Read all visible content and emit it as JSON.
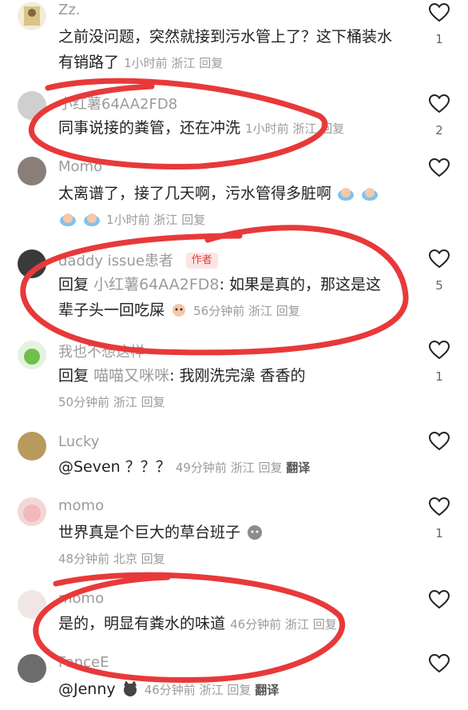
{
  "comments": [
    {
      "name": "Zz.",
      "text": "之前没问题，突然就接到污水管上了？这下桶装水有销路了",
      "time": "1小时前",
      "loc": "浙江",
      "reply": "回复",
      "likes": "1"
    },
    {
      "name": "小红薯64AA2FD8",
      "text": "同事说接的粪管，还在冲洗",
      "time": "1小时前",
      "loc": "浙江",
      "reply": "回复",
      "likes": "2"
    },
    {
      "name": "Momo",
      "text": "太离谱了，接了几天啊，污水管得多脏啊",
      "time": "1小时前",
      "loc": "浙江",
      "reply": "回复",
      "likes": ""
    },
    {
      "name": "daddy issue患者",
      "badge": "作者",
      "reply_prefix": "回复",
      "reply_to": "小红薯64AA2FD8",
      "text": ": 如果是真的，那这是这辈子头一回吃屎",
      "time": "56分钟前",
      "loc": "浙江",
      "reply": "回复",
      "likes": "5"
    },
    {
      "name": "我也不想这样",
      "reply_prefix": "回复",
      "reply_to": "喵喵又咪咪",
      "text": ": 我刚洗完澡 香香的",
      "time": "50分钟前",
      "loc": "浙江",
      "reply": "回复",
      "likes": "1"
    },
    {
      "name": "Lucky",
      "text": "@Seven ？？？",
      "time": "49分钟前",
      "loc": "浙江",
      "reply": "回复",
      "translate": "翻译",
      "likes": ""
    },
    {
      "name": "momo",
      "text": "世界真是个巨大的草台班子",
      "time": "48分钟前",
      "loc": "北京",
      "reply": "回复",
      "likes": "1"
    },
    {
      "name": "momo",
      "text": "是的，明显有粪水的味道",
      "time": "46分钟前",
      "loc": "浙江",
      "reply": "回复",
      "likes": ""
    },
    {
      "name": "FanceE",
      "text": "@Jenny",
      "time": "46分钟前",
      "loc": "浙江",
      "reply": "回复",
      "translate": "翻译",
      "likes": ""
    }
  ],
  "colors": {
    "annotation": "#e8393a",
    "muted": "#9b9b9b",
    "badge": "#e0413c"
  },
  "icons": {
    "like": "heart-outline-icon"
  }
}
